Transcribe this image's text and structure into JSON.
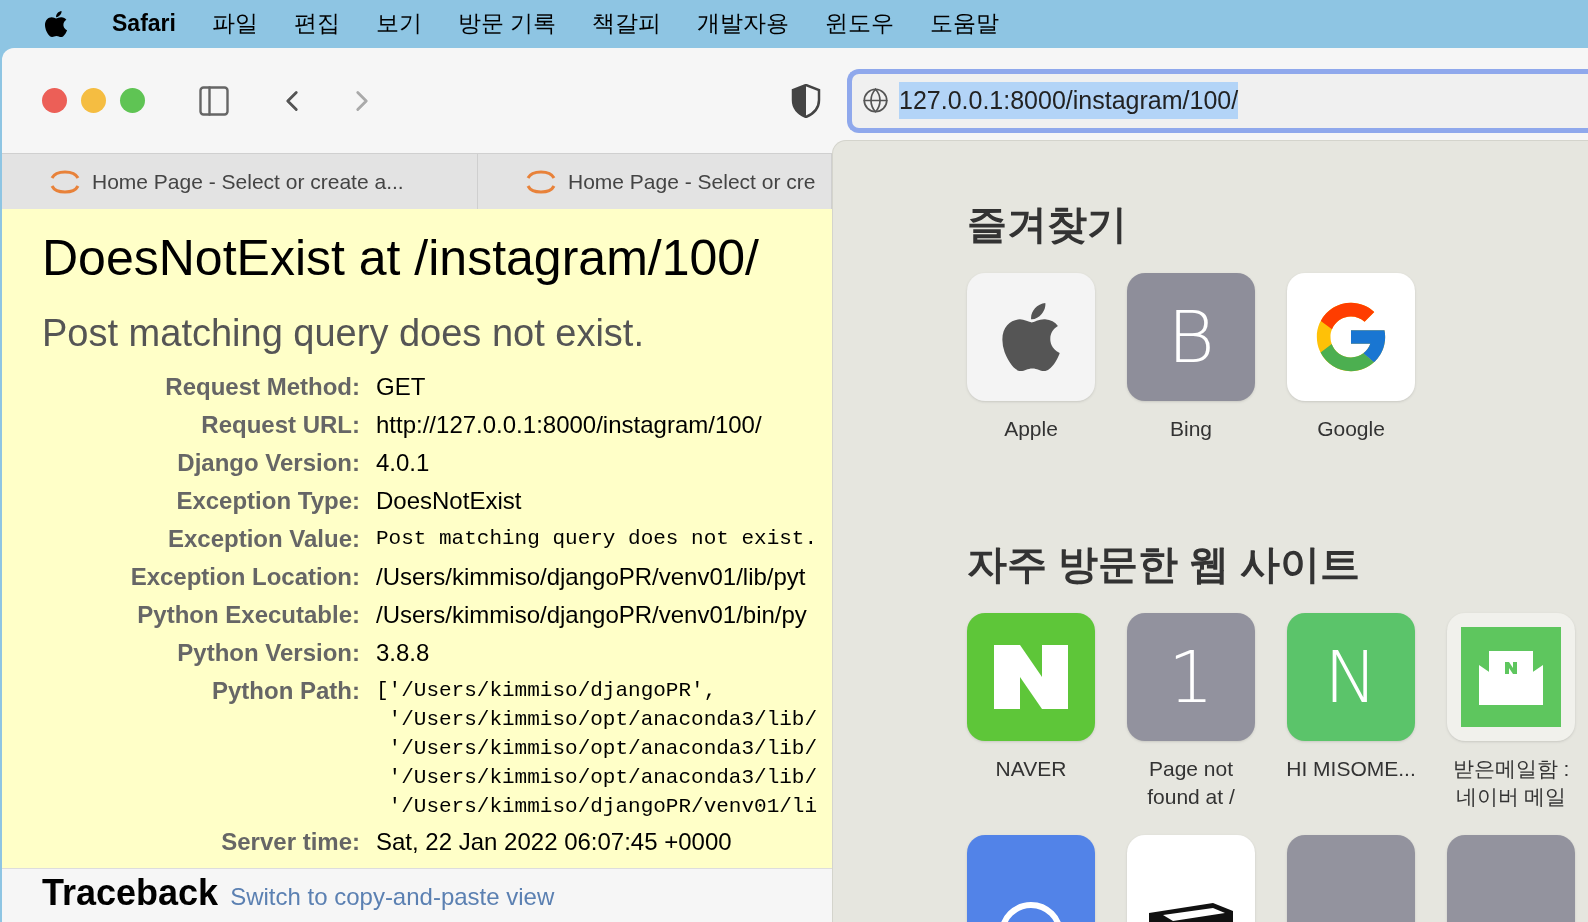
{
  "menu_bar": {
    "app": "Safari",
    "items": [
      "파일",
      "편집",
      "보기",
      "방문 기록",
      "책갈피",
      "개발자용",
      "윈도우",
      "도움말"
    ]
  },
  "address_bar": {
    "url": "127.0.0.1:8000/instagram/100/",
    "selected": true
  },
  "tabs": [
    {
      "title": "Home Page - Select or create a..."
    },
    {
      "title": "Home Page - Select or cre"
    }
  ],
  "error_page": {
    "title": "DoesNotExist at /instagram/100/",
    "message": "Post matching query does not exist.",
    "rows": [
      {
        "label": "Request Method:",
        "kind": "text",
        "lines": [
          "GET"
        ]
      },
      {
        "label": "Request URL:",
        "kind": "text",
        "lines": [
          "http://127.0.0.1:8000/instagram/100/"
        ]
      },
      {
        "label": "Django Version:",
        "kind": "text",
        "lines": [
          "4.0.1"
        ]
      },
      {
        "label": "Exception Type:",
        "kind": "text",
        "lines": [
          "DoesNotExist"
        ]
      },
      {
        "label": "Exception Value:",
        "kind": "code",
        "lines": [
          "Post matching query does not exist."
        ]
      },
      {
        "label": "Exception Location:",
        "kind": "text",
        "lines": [
          "/Users/kimmiso/djangoPR/venv01/lib/pyt"
        ]
      },
      {
        "label": "Python Executable:",
        "kind": "text",
        "lines": [
          "/Users/kimmiso/djangoPR/venv01/bin/py"
        ]
      },
      {
        "label": "Python Version:",
        "kind": "text",
        "lines": [
          "3.8.8"
        ]
      },
      {
        "label": "Python Path:",
        "kind": "code",
        "lines": [
          "['/Users/kimmiso/djangoPR',",
          " '/Users/kimmiso/opt/anaconda3/lib/",
          " '/Users/kimmiso/opt/anaconda3/lib/",
          " '/Users/kimmiso/opt/anaconda3/lib/",
          " '/Users/kimmiso/djangoPR/venv01/li"
        ]
      },
      {
        "label": "Server time:",
        "kind": "text",
        "lines": [
          "Sat, 22 Jan 2022 06:07:45 +0000"
        ]
      }
    ],
    "traceback": {
      "title": "Traceback",
      "link": "Switch to copy-and-paste view"
    }
  },
  "start_panel": {
    "favorites_title": "즐겨찾기",
    "favorites": [
      {
        "label": "Apple",
        "kind": "apple"
      },
      {
        "label": "Bing",
        "kind": "letter",
        "letter": "B",
        "color": "#8e8e9a"
      },
      {
        "label": "Google",
        "kind": "google"
      }
    ],
    "frequent_title": "자주 방문한 웹 사이트",
    "frequent": [
      {
        "label": "NAVER",
        "kind": "naver"
      },
      {
        "label": "Page not found at /",
        "kind": "letter",
        "letter": "1",
        "color": "#92929e"
      },
      {
        "label": "HI MISOME...",
        "kind": "letter",
        "letter": "N",
        "color": "#5bc46a"
      },
      {
        "label": "받은메일함 : 네이버 메일",
        "kind": "mail"
      },
      {
        "kind": "blue"
      },
      {
        "kind": "box"
      },
      {
        "kind": "gray"
      },
      {
        "kind": "gray"
      }
    ]
  }
}
